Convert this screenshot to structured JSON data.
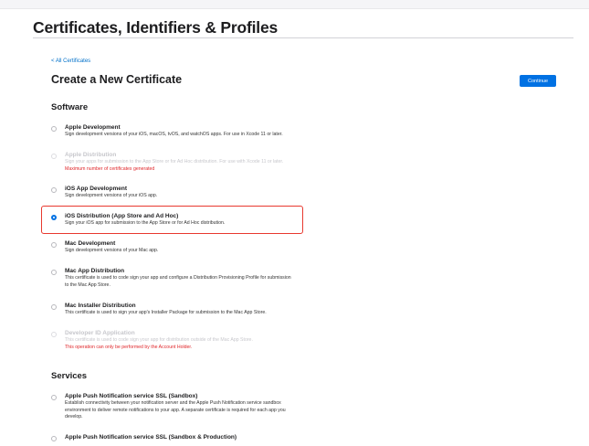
{
  "header": {
    "title": "Certificates, Identifiers & Profiles"
  },
  "nav": {
    "back_label": "< All Certificates"
  },
  "main": {
    "heading": "Create a New Certificate",
    "continue_label": "Continue"
  },
  "software": {
    "heading": "Software",
    "options": [
      {
        "title": "Apple Development",
        "desc": "Sign development versions of your iOS, macOS, tvOS, and watchOS apps. For use in Xcode 11 or later.",
        "selected": false,
        "disabled": false
      },
      {
        "title": "Apple Distribution",
        "desc": "Sign your apps for submission to the App Store or for Ad Hoc distribution. For use with Xcode 11 or later.",
        "warning": "Maximum number of certificates generated",
        "selected": false,
        "disabled": true
      },
      {
        "title": "iOS App Development",
        "desc": "Sign development versions of your iOS app.",
        "selected": false,
        "disabled": false
      },
      {
        "title": "iOS Distribution (App Store and Ad Hoc)",
        "desc": "Sign your iOS app for submission to the App Store or for Ad Hoc distribution.",
        "selected": true,
        "disabled": false
      },
      {
        "title": "Mac Development",
        "desc": "Sign development versions of your Mac app.",
        "selected": false,
        "disabled": false
      },
      {
        "title": "Mac App Distribution",
        "desc": "This certificate is used to code sign your app and configure a Distribution Provisioning Profile for submission",
        "desc2": "to the Mac App Store.",
        "selected": false,
        "disabled": false
      },
      {
        "title": "Mac Installer Distribution",
        "desc": "This certificate is used to sign your app's Installer Package for submission to the Mac App Store.",
        "selected": false,
        "disabled": false
      },
      {
        "title": "Developer ID Application",
        "desc": "This certificate is used to code sign your app for distribution outside of the Mac App Store.",
        "warning": "This operation can only be performed by the Account Holder.",
        "selected": false,
        "disabled": true
      }
    ]
  },
  "services": {
    "heading": "Services",
    "options": [
      {
        "title": "Apple Push Notification service SSL (Sandbox)",
        "desc": "Establish connectivity between your notification server and the Apple Push Notification service sandbox",
        "desc2": "environment to deliver remote notifications to your app. A separate certificate is required for each app you",
        "desc3": "develop.",
        "selected": false,
        "disabled": false
      },
      {
        "title": "Apple Push Notification service SSL (Sandbox & Production)",
        "selected": false,
        "disabled": false
      }
    ]
  },
  "colors": {
    "accent": "#0071e3",
    "link": "#0070c9",
    "warning": "#e0262a",
    "highlight": "#e8392f"
  }
}
